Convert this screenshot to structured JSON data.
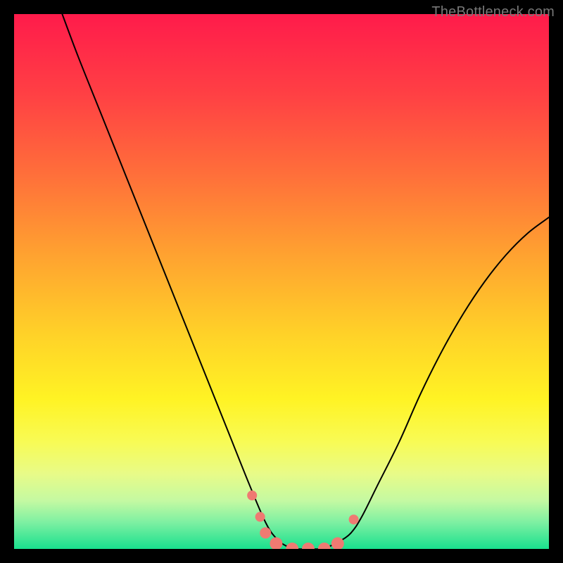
{
  "attribution": "TheBottleneck.com",
  "chart_data": {
    "type": "line",
    "title": "",
    "xlabel": "",
    "ylabel": "",
    "xlim": [
      0,
      100
    ],
    "ylim": [
      0,
      100
    ],
    "series": [
      {
        "name": "curve",
        "x": [
          9,
          12,
          16,
          20,
          24,
          28,
          32,
          36,
          40,
          44,
          47,
          49,
          51,
          53,
          55,
          57,
          59,
          61,
          63,
          65,
          68,
          72,
          76,
          80,
          84,
          88,
          92,
          96,
          100
        ],
        "y": [
          100,
          92,
          82,
          72,
          62,
          52,
          42,
          32,
          22,
          12,
          5,
          2,
          0.5,
          0,
          0,
          0,
          0.5,
          1.5,
          3,
          6,
          12,
          20,
          29,
          37,
          44,
          50,
          55,
          59,
          62
        ],
        "stroke": "#000000",
        "stroke_width": 2
      },
      {
        "name": "markers",
        "type": "scatter",
        "points": [
          {
            "x": 44.5,
            "y": 10,
            "r": 7
          },
          {
            "x": 46.0,
            "y": 6,
            "r": 7
          },
          {
            "x": 47.0,
            "y": 3,
            "r": 8
          },
          {
            "x": 49.0,
            "y": 1,
            "r": 9
          },
          {
            "x": 52.0,
            "y": 0,
            "r": 9
          },
          {
            "x": 55.0,
            "y": 0,
            "r": 9
          },
          {
            "x": 58.0,
            "y": 0,
            "r": 9
          },
          {
            "x": 60.5,
            "y": 1,
            "r": 9
          },
          {
            "x": 63.5,
            "y": 5.5,
            "r": 7
          }
        ],
        "fill": "#ef7a72"
      }
    ],
    "gradient_stops": [
      {
        "offset": 0,
        "color": "#ff1b4b"
      },
      {
        "offset": 0.15,
        "color": "#ff4044"
      },
      {
        "offset": 0.3,
        "color": "#ff6f3a"
      },
      {
        "offset": 0.45,
        "color": "#ffa230"
      },
      {
        "offset": 0.6,
        "color": "#ffd228"
      },
      {
        "offset": 0.72,
        "color": "#fff324"
      },
      {
        "offset": 0.8,
        "color": "#f8fb55"
      },
      {
        "offset": 0.86,
        "color": "#e8fb88"
      },
      {
        "offset": 0.91,
        "color": "#c4f9a2"
      },
      {
        "offset": 0.95,
        "color": "#7ef0a2"
      },
      {
        "offset": 1.0,
        "color": "#19e08e"
      }
    ]
  }
}
